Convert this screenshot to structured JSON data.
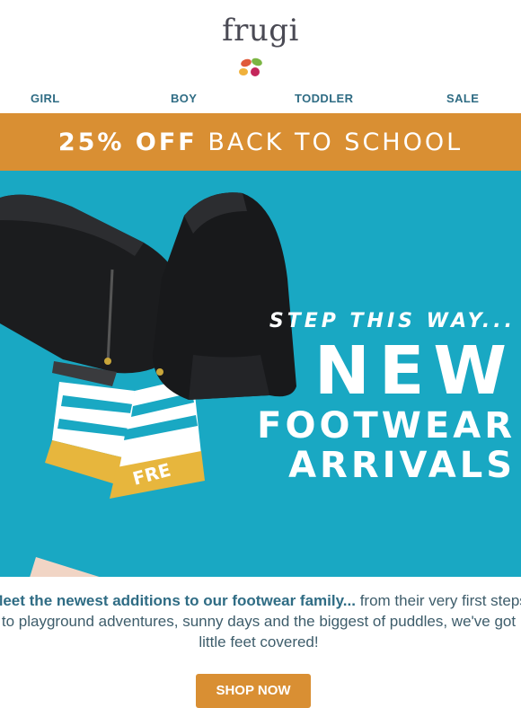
{
  "brand": {
    "logo_text": "frugi"
  },
  "nav": {
    "girl": "GIRL",
    "boy": "BOY",
    "toddler": "TODDLER",
    "sale": "SALE"
  },
  "promo": {
    "bold": "25% OFF",
    "rest": "BACK TO SCHOOL"
  },
  "hero": {
    "line1": "STEP THIS WAY...",
    "line2": "NEW",
    "line3": "FOOTWEAR",
    "line4": "ARRIVALS",
    "sock_text": "FRE"
  },
  "copy": {
    "lead": "Meet the newest additions to our footwear family...",
    "rest": " from their very first steps to playground adventures, sunny days and the biggest of puddles, we've got little feet covered!"
  },
  "cta": {
    "label": "SHOP NOW"
  },
  "colors": {
    "orange": "#d98f33",
    "teal": "#19a8c3",
    "nav_blue": "#2f6c84"
  }
}
